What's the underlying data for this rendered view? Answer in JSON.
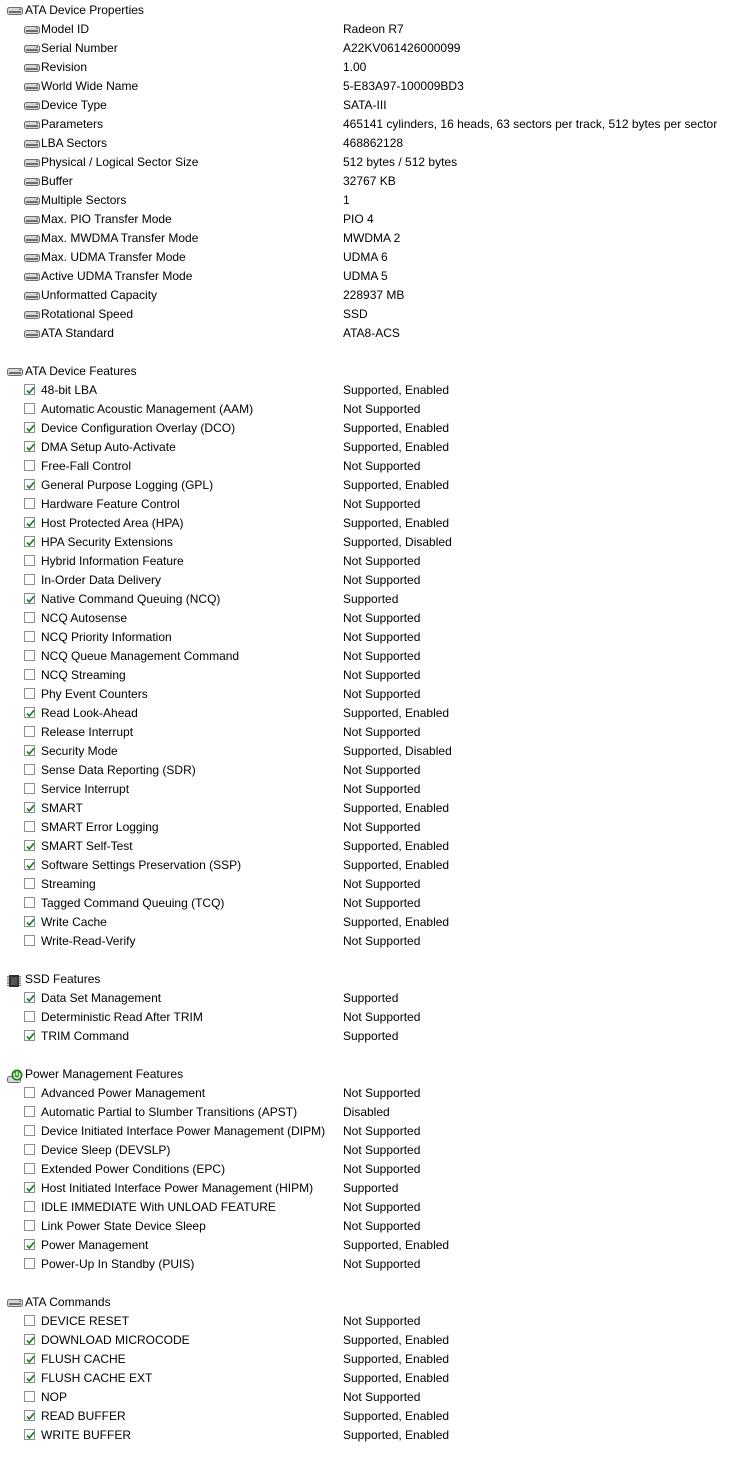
{
  "sections": [
    {
      "title": "ATA Device Properties",
      "icon": "drive-icon",
      "kind": "props",
      "items": [
        {
          "label": "Model ID",
          "value": "Radeon R7"
        },
        {
          "label": "Serial Number",
          "value": "A22KV061426000099"
        },
        {
          "label": "Revision",
          "value": "1.00"
        },
        {
          "label": "World Wide Name",
          "value": "5-E83A97-100009BD3"
        },
        {
          "label": "Device Type",
          "value": "SATA-III"
        },
        {
          "label": "Parameters",
          "value": "465141 cylinders, 16 heads, 63 sectors per track, 512 bytes per sector"
        },
        {
          "label": "LBA Sectors",
          "value": "468862128"
        },
        {
          "label": "Physical / Logical Sector Size",
          "value": "512 bytes / 512 bytes"
        },
        {
          "label": "Buffer",
          "value": "32767 KB"
        },
        {
          "label": "Multiple Sectors",
          "value": "1"
        },
        {
          "label": "Max. PIO Transfer Mode",
          "value": "PIO 4"
        },
        {
          "label": "Max. MWDMA Transfer Mode",
          "value": "MWDMA 2"
        },
        {
          "label": "Max. UDMA Transfer Mode",
          "value": "UDMA 6"
        },
        {
          "label": "Active UDMA Transfer Mode",
          "value": "UDMA 5"
        },
        {
          "label": "Unformatted Capacity",
          "value": "228937 MB"
        },
        {
          "label": "Rotational Speed",
          "value": "SSD"
        },
        {
          "label": "ATA Standard",
          "value": "ATA8-ACS"
        }
      ]
    },
    {
      "title": "ATA Device Features",
      "icon": "drive-icon",
      "kind": "checks",
      "items": [
        {
          "label": "48-bit LBA",
          "checked": true,
          "value": "Supported, Enabled"
        },
        {
          "label": "Automatic Acoustic Management (AAM)",
          "checked": false,
          "value": "Not Supported"
        },
        {
          "label": "Device Configuration Overlay (DCO)",
          "checked": true,
          "value": "Supported, Enabled"
        },
        {
          "label": "DMA Setup Auto-Activate",
          "checked": true,
          "value": "Supported, Enabled"
        },
        {
          "label": "Free-Fall Control",
          "checked": false,
          "value": "Not Supported"
        },
        {
          "label": "General Purpose Logging (GPL)",
          "checked": true,
          "value": "Supported, Enabled"
        },
        {
          "label": "Hardware Feature Control",
          "checked": false,
          "value": "Not Supported"
        },
        {
          "label": "Host Protected Area (HPA)",
          "checked": true,
          "value": "Supported, Enabled"
        },
        {
          "label": "HPA Security Extensions",
          "checked": true,
          "value": "Supported, Disabled"
        },
        {
          "label": "Hybrid Information Feature",
          "checked": false,
          "value": "Not Supported"
        },
        {
          "label": "In-Order Data Delivery",
          "checked": false,
          "value": "Not Supported"
        },
        {
          "label": "Native Command Queuing (NCQ)",
          "checked": true,
          "value": "Supported"
        },
        {
          "label": "NCQ Autosense",
          "checked": false,
          "value": "Not Supported"
        },
        {
          "label": "NCQ Priority Information",
          "checked": false,
          "value": "Not Supported"
        },
        {
          "label": "NCQ Queue Management Command",
          "checked": false,
          "value": "Not Supported"
        },
        {
          "label": "NCQ Streaming",
          "checked": false,
          "value": "Not Supported"
        },
        {
          "label": "Phy Event Counters",
          "checked": false,
          "value": "Not Supported"
        },
        {
          "label": "Read Look-Ahead",
          "checked": true,
          "value": "Supported, Enabled"
        },
        {
          "label": "Release Interrupt",
          "checked": false,
          "value": "Not Supported"
        },
        {
          "label": "Security Mode",
          "checked": true,
          "value": "Supported, Disabled"
        },
        {
          "label": "Sense Data Reporting (SDR)",
          "checked": false,
          "value": "Not Supported"
        },
        {
          "label": "Service Interrupt",
          "checked": false,
          "value": "Not Supported"
        },
        {
          "label": "SMART",
          "checked": true,
          "value": "Supported, Enabled"
        },
        {
          "label": "SMART Error Logging",
          "checked": false,
          "value": "Not Supported"
        },
        {
          "label": "SMART Self-Test",
          "checked": true,
          "value": "Supported, Enabled"
        },
        {
          "label": "Software Settings Preservation (SSP)",
          "checked": true,
          "value": "Supported, Enabled"
        },
        {
          "label": "Streaming",
          "checked": false,
          "value": "Not Supported"
        },
        {
          "label": "Tagged Command Queuing (TCQ)",
          "checked": false,
          "value": "Not Supported"
        },
        {
          "label": "Write Cache",
          "checked": true,
          "value": "Supported, Enabled"
        },
        {
          "label": "Write-Read-Verify",
          "checked": false,
          "value": "Not Supported"
        }
      ]
    },
    {
      "title": "SSD Features",
      "icon": "ssd-chip-icon",
      "kind": "checks",
      "items": [
        {
          "label": "Data Set Management",
          "checked": true,
          "value": "Supported"
        },
        {
          "label": "Deterministic Read After TRIM",
          "checked": false,
          "value": "Not Supported"
        },
        {
          "label": "TRIM Command",
          "checked": true,
          "value": "Supported"
        }
      ]
    },
    {
      "title": "Power Management Features",
      "icon": "power-management-icon",
      "kind": "checks",
      "items": [
        {
          "label": "Advanced Power Management",
          "checked": false,
          "value": "Not Supported"
        },
        {
          "label": "Automatic Partial to Slumber Transitions (APST)",
          "checked": false,
          "value": "Disabled"
        },
        {
          "label": "Device Initiated Interface Power Management (DIPM)",
          "checked": false,
          "value": "Not Supported"
        },
        {
          "label": "Device Sleep (DEVSLP)",
          "checked": false,
          "value": "Not Supported"
        },
        {
          "label": "Extended Power Conditions (EPC)",
          "checked": false,
          "value": "Not Supported"
        },
        {
          "label": "Host Initiated Interface Power Management (HIPM)",
          "checked": true,
          "value": "Supported"
        },
        {
          "label": "IDLE IMMEDIATE With UNLOAD FEATURE",
          "checked": false,
          "value": "Not Supported"
        },
        {
          "label": "Link Power State Device Sleep",
          "checked": false,
          "value": "Not Supported"
        },
        {
          "label": "Power Management",
          "checked": true,
          "value": "Supported, Enabled"
        },
        {
          "label": "Power-Up In Standby (PUIS)",
          "checked": false,
          "value": "Not Supported"
        }
      ]
    },
    {
      "title": "ATA Commands",
      "icon": "drive-icon",
      "kind": "checks",
      "items": [
        {
          "label": "DEVICE RESET",
          "checked": false,
          "value": "Not Supported"
        },
        {
          "label": "DOWNLOAD MICROCODE",
          "checked": true,
          "value": "Supported, Enabled"
        },
        {
          "label": "FLUSH CACHE",
          "checked": true,
          "value": "Supported, Enabled"
        },
        {
          "label": "FLUSH CACHE EXT",
          "checked": true,
          "value": "Supported, Enabled"
        },
        {
          "label": "NOP",
          "checked": false,
          "value": "Not Supported"
        },
        {
          "label": "READ BUFFER",
          "checked": true,
          "value": "Supported, Enabled"
        },
        {
          "label": "WRITE BUFFER",
          "checked": true,
          "value": "Supported, Enabled"
        }
      ]
    }
  ],
  "colors": {
    "checkmark": "#2a7a2a",
    "checkbox_border": "#8f8f8f",
    "drive_body": "#d7d7d7",
    "drive_dark": "#6e6e6e",
    "ssd_chip": "#333333",
    "power_green": "#3a9c2e"
  }
}
